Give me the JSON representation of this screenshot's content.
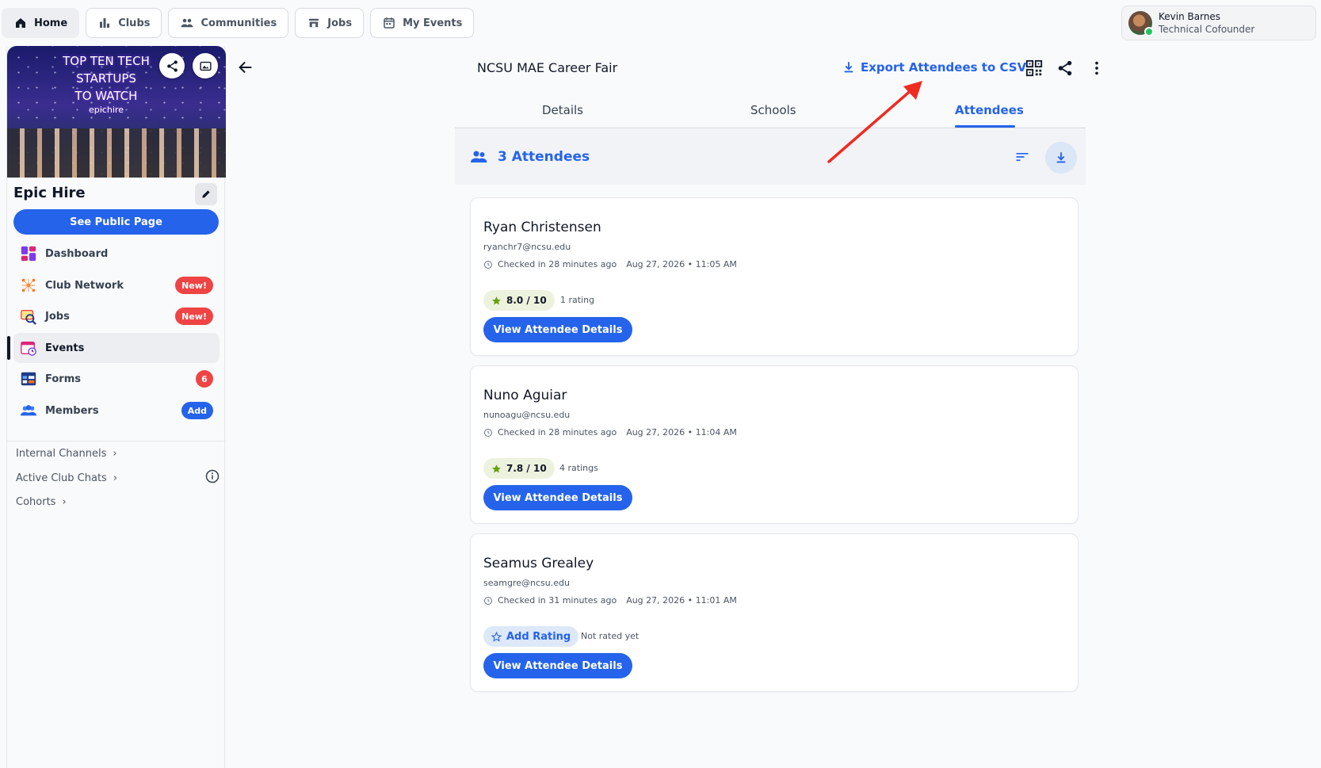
{
  "topnav": {
    "items": [
      {
        "label": "Home",
        "icon": "home-icon"
      },
      {
        "label": "Clubs",
        "icon": "bar-chart-icon"
      },
      {
        "label": "Communities",
        "icon": "group-icon"
      },
      {
        "label": "Jobs",
        "icon": "store-icon"
      },
      {
        "label": "My Events",
        "icon": "calendar-icon"
      }
    ]
  },
  "user": {
    "name": "Kevin Barnes",
    "role": "Technical Cofounder"
  },
  "sidebar": {
    "banner_title_line1": "TOP TEN TECH STARTUPS",
    "banner_title_line2": "TO WATCH",
    "banner_brand": "epichire",
    "club_name": "Epic Hire",
    "public_page_label": "See Public Page",
    "items": [
      {
        "label": "Dashboard",
        "badge": ""
      },
      {
        "label": "Club Network",
        "badge": "New!"
      },
      {
        "label": "Jobs",
        "badge": "New!"
      },
      {
        "label": "Events",
        "badge": ""
      },
      {
        "label": "Forms",
        "badge": "6"
      },
      {
        "label": "Members",
        "badge": "Add"
      }
    ],
    "links": [
      {
        "label": "Internal Channels"
      },
      {
        "label": "Active Club Chats"
      },
      {
        "label": "Cohorts"
      }
    ]
  },
  "header": {
    "event_title": "NCSU MAE Career Fair",
    "export_label": "Export Attendees to CSV"
  },
  "tabs": [
    {
      "label": "Details"
    },
    {
      "label": "Schools"
    },
    {
      "label": "Attendees"
    }
  ],
  "attendees_summary": {
    "count_label": "3 Attendees"
  },
  "attendees": [
    {
      "name": "Ryan Christensen",
      "email": "ryanchr7@ncsu.edu",
      "checked_in": "Checked in 28 minutes ago",
      "datetime": "Aug 27, 2026 • 11:05 AM",
      "rating": "8.0 / 10",
      "rating_count": "1 rating",
      "button_label": "View Attendee Details"
    },
    {
      "name": "Nuno Aguiar",
      "email": "nunoagu@ncsu.edu",
      "checked_in": "Checked in 28 minutes ago",
      "datetime": "Aug 27, 2026 • 11:04 AM",
      "rating": "7.8 / 10",
      "rating_count": "4 ratings",
      "button_label": "View Attendee Details"
    },
    {
      "name": "Seamus Grealey",
      "email": "seamgre@ncsu.edu",
      "checked_in": "Checked in 31 minutes ago",
      "datetime": "Aug 27, 2026 • 11:01 AM",
      "add_rating_label": "Add Rating",
      "not_rated_label": "Not rated yet",
      "button_label": "View Attendee Details"
    }
  ],
  "colors": {
    "accent": "#2563eb",
    "badge_red": "#ef4444",
    "annotation_arrow": "#ef2b22"
  }
}
